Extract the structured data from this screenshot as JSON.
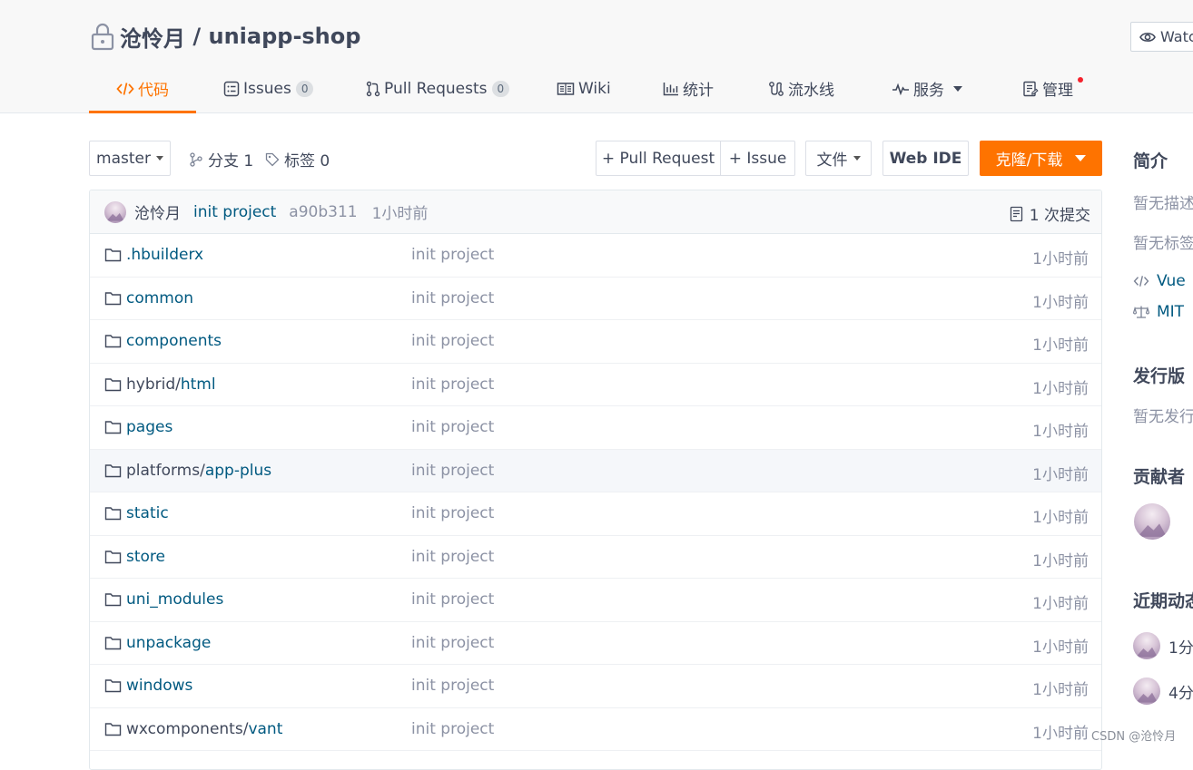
{
  "repo": {
    "owner": "沧怜月",
    "separator": " / ",
    "name": "uniapp-shop"
  },
  "watch": {
    "label": "Watch"
  },
  "nav": {
    "code": "代码",
    "issues": "Issues",
    "issues_count": "0",
    "pulls": "Pull Requests",
    "pulls_count": "0",
    "wiki": "Wiki",
    "stats": "统计",
    "pipeline": "流水线",
    "services": "服务",
    "manage": "管理"
  },
  "toolbar": {
    "branch": "master",
    "branches": "分支 1",
    "tags": "标签 0",
    "new_pr": "+ Pull Request",
    "new_issue": "+ Issue",
    "file": "文件",
    "web_ide": "Web IDE",
    "clone": "克隆/下载"
  },
  "commit": {
    "author": "沧怜月",
    "message": "init project",
    "sha": "a90b311",
    "time": "1小时前",
    "count": "1 次提交"
  },
  "files": [
    {
      "prefix": "",
      "name": ".hbuilderx",
      "message": "init project",
      "time": "1小时前"
    },
    {
      "prefix": "",
      "name": "common",
      "message": "init project",
      "time": "1小时前"
    },
    {
      "prefix": "",
      "name": "components",
      "message": "init project",
      "time": "1小时前"
    },
    {
      "prefix": "hybrid/",
      "name": "html",
      "message": "init project",
      "time": "1小时前"
    },
    {
      "prefix": "",
      "name": "pages",
      "message": "init project",
      "time": "1小时前"
    },
    {
      "prefix": "platforms/",
      "name": "app-plus",
      "message": "init project",
      "time": "1小时前"
    },
    {
      "prefix": "",
      "name": "static",
      "message": "init project",
      "time": "1小时前"
    },
    {
      "prefix": "",
      "name": "store",
      "message": "init project",
      "time": "1小时前"
    },
    {
      "prefix": "",
      "name": "uni_modules",
      "message": "init project",
      "time": "1小时前"
    },
    {
      "prefix": "",
      "name": "unpackage",
      "message": "init project",
      "time": "1小时前"
    },
    {
      "prefix": "",
      "name": "windows",
      "message": "init project",
      "time": "1小时前"
    },
    {
      "prefix": "wxcomponents/",
      "name": "vant",
      "message": "init project",
      "time": "1小时前"
    }
  ],
  "sidebar": {
    "intro_title": "简介",
    "no_description": "暂无描述",
    "no_tags": "暂无标签",
    "language": "Vue",
    "license": "MIT",
    "releases_title": "发行版",
    "no_releases": "暂无发行版",
    "contributors_title": "贡献者",
    "activity_title": "近期动态",
    "activity_1": "1分",
    "activity_2": "4分"
  },
  "watermark": "CSDN @沧怜月",
  "colors": {
    "accent": "#fe7300",
    "link": "#005980",
    "muted": "#8c92a4"
  }
}
